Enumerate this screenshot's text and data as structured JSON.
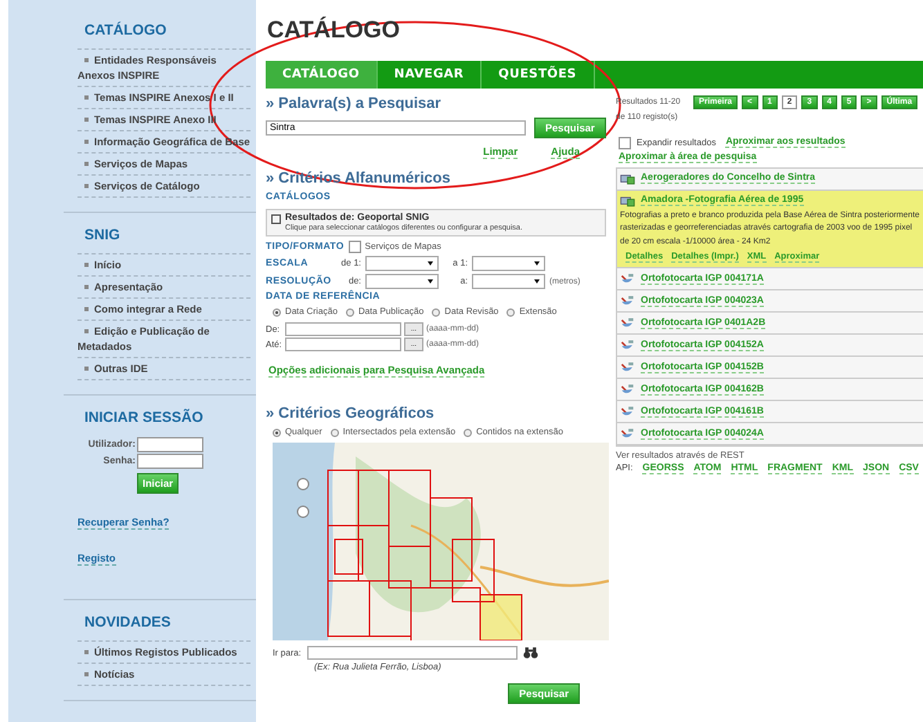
{
  "sidebar": {
    "sections": [
      {
        "title": "CATÁLOGO",
        "items": [
          {
            "label": "Entidades Responsáveis Anexos INSPIRE"
          },
          {
            "label": "Temas INSPIRE Anexos I e II"
          },
          {
            "label": "Temas INSPIRE Anexo III"
          },
          {
            "label": "Informação Geográfica de Base"
          },
          {
            "label": "Serviços de Mapas"
          },
          {
            "label": "Serviços de Catálogo"
          }
        ]
      },
      {
        "title": "SNIG",
        "items": [
          {
            "label": "Início"
          },
          {
            "label": "Apresentação"
          },
          {
            "label": "Como integrar a Rede"
          },
          {
            "label": "Edição e Publicação de Metadados"
          },
          {
            "label": "Outras IDE"
          }
        ]
      }
    ],
    "login": {
      "title": "INICIAR SESSÃO",
      "fields": [
        {
          "label": "Utilizador:"
        },
        {
          "label": "Senha:"
        }
      ],
      "button": "Iniciar",
      "links": [
        "Recuperar Senha?",
        "Registo"
      ]
    },
    "news": {
      "title": "NOVIDADES",
      "items": [
        {
          "label": "Últimos Registos Publicados"
        },
        {
          "label": "Notícias"
        }
      ]
    }
  },
  "page_title": "CATÁLOGO",
  "tabs": [
    {
      "label": "CATÁLOGO",
      "selected": true
    },
    {
      "label": "NAVEGAR",
      "selected": false
    },
    {
      "label": "QUESTÕES",
      "selected": false
    }
  ],
  "search": {
    "heading": "» Palavra(s) a Pesquisar",
    "value": "Sintra",
    "button": "Pesquisar",
    "links": [
      "Limpar",
      "Ajuda"
    ]
  },
  "alphanumeric": {
    "heading": "» Critérios Alfanuméricos",
    "catalogs_label": "CATÁLOGOS",
    "catalog_box": {
      "title": "Resultados de: Geoportal SNIG",
      "hint": "Clique para seleccionar catálogos diferentes ou configurar a pesquisa."
    },
    "type_label": "TIPO/FORMATO",
    "type_option": {
      "label": "Serviços de Mapas",
      "checked": false
    },
    "scale": {
      "label": "ESCALA",
      "from": "de 1:",
      "to": "a 1:"
    },
    "resolution": {
      "label": "RESOLUÇÃO",
      "from": "de:",
      "to": "a:",
      "unit": "(metros)"
    },
    "date": {
      "label": "DATA DE REFERÊNCIA",
      "options": [
        {
          "label": "Data Criação",
          "selected": true
        },
        {
          "label": "Data Publicação",
          "selected": false
        },
        {
          "label": "Data Revisão",
          "selected": false
        },
        {
          "label": "Extensão",
          "selected": false
        }
      ],
      "fields": [
        {
          "label": "De:",
          "button": "...",
          "hint": "(aaaa-mm-dd)"
        },
        {
          "label": "Até:",
          "button": "...",
          "hint": "(aaaa-mm-dd)"
        }
      ]
    },
    "advanced_link": "Opções adicionais para Pesquisa Avançada"
  },
  "geographic": {
    "heading": "» Critérios Geográficos",
    "options": [
      {
        "label": "Qualquer",
        "selected": true
      },
      {
        "label": "Intersectados pela extensão",
        "selected": false
      },
      {
        "label": "Contidos na extensão",
        "selected": false
      }
    ],
    "goto_label": "Ir para:",
    "goto_example": "(Ex: Rua Julieta Ferrão, Lisboa)",
    "submit": "Pesquisar"
  },
  "results": {
    "summary": "Resultados 11-20 de 110 registo(s)",
    "pagination": [
      {
        "label": "Primeira",
        "selected": false
      },
      {
        "label": "<",
        "selected": false
      },
      {
        "label": "1",
        "selected": false
      },
      {
        "label": "2",
        "selected": true
      },
      {
        "label": "3",
        "selected": false
      },
      {
        "label": "4",
        "selected": false
      },
      {
        "label": "5",
        "selected": false
      },
      {
        "label": ">",
        "selected": false
      },
      {
        "label": "Última",
        "selected": false
      }
    ],
    "expand": {
      "label": "Expandir resultados",
      "checked": false
    },
    "zoom_links": [
      "Aproximar aos resultados",
      "Aproximar à área de pesquisa"
    ],
    "items": [
      {
        "kind": "layer",
        "title": "Aerogeradores do Concelho de Sintra",
        "expanded": false
      },
      {
        "kind": "layer",
        "title": "Amadora -Fotografia Aérea de 1995",
        "expanded": true,
        "description": "Fotografias a preto e branco produzida pela Base Aérea de Sintra posteriormente rasterizadas e georreferenciadas através cartografia de 2003 voo de 1995 pixel de 20 cm escala -1/10000 área - 24 Km2",
        "actions": [
          "Detalhes",
          "Detalhes (Impr.)",
          "XML",
          "Aproximar"
        ]
      },
      {
        "kind": "ortho",
        "title": "Ortofotocarta IGP 004171A",
        "expanded": false
      },
      {
        "kind": "ortho",
        "title": "Ortofotocarta IGP 004023A",
        "expanded": false
      },
      {
        "kind": "ortho",
        "title": "Ortofotocarta IGP 0401A2B",
        "expanded": false
      },
      {
        "kind": "ortho",
        "title": "Ortofotocarta IGP 004152A",
        "expanded": false
      },
      {
        "kind": "ortho",
        "title": "Ortofotocarta IGP 004152B",
        "expanded": false
      },
      {
        "kind": "ortho",
        "title": "Ortofotocarta IGP 004162B",
        "expanded": false
      },
      {
        "kind": "ortho",
        "title": "Ortofotocarta IGP 004161B",
        "expanded": false
      },
      {
        "kind": "ortho",
        "title": "Ortofotocarta IGP 004024A",
        "expanded": false
      }
    ],
    "rest_label": "Ver resultados através de REST",
    "api_label": "API:",
    "api_links": [
      "GEORSS",
      "ATOM",
      "HTML",
      "FRAGMENT",
      "KML",
      "JSON",
      "CSV"
    ]
  }
}
